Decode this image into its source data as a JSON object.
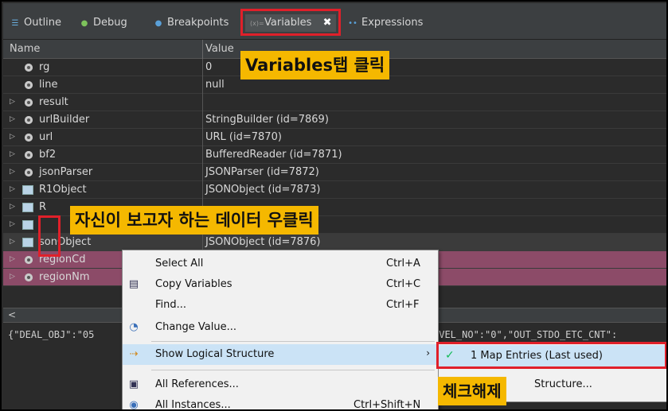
{
  "tabs": [
    {
      "label": "Outline",
      "icon": "outline-icon"
    },
    {
      "label": "Debug",
      "icon": "debug-icon"
    },
    {
      "label": "Breakpoints",
      "icon": "breakpoints-icon"
    },
    {
      "label": "Variables",
      "icon": "variables-icon",
      "active": true
    },
    {
      "label": "Expressions",
      "icon": "expressions-icon"
    }
  ],
  "columns": {
    "name": "Name",
    "value": "Value"
  },
  "rows": [
    {
      "name": "rg",
      "value": "0",
      "expandable": false
    },
    {
      "name": "line",
      "value": "null",
      "expandable": false
    },
    {
      "name": "result",
      "value": "",
      "expandable": true
    },
    {
      "name": "urlBuilder",
      "value": "StringBuilder  (id=7869)",
      "expandable": true
    },
    {
      "name": "url",
      "value": "URL  (id=7870)",
      "expandable": true
    },
    {
      "name": "bf2",
      "value": "BufferedReader  (id=7871)",
      "expandable": true
    },
    {
      "name": "jsonParser",
      "value": "JSONParser  (id=7872)",
      "expandable": true
    },
    {
      "name": "R1Object",
      "value": "JSONObject  (id=7873)",
      "expandable": true
    },
    {
      "name": "R",
      "value": "",
      "expandable": true
    },
    {
      "name": "",
      "value": "",
      "expandable": true
    },
    {
      "name": "sonObject",
      "value": "JSONObject  (id=7876)",
      "expandable": true
    },
    {
      "name": "regionCd",
      "value": "",
      "expandable": true
    },
    {
      "name": "regionNm",
      "value": "",
      "expandable": true
    }
  ],
  "detail": {
    "left": "{\"DEAL_OBJ\":\"05",
    "right": "EVEL_NO\":\"0\",\"OUT_STDO_ETC_CNT\":"
  },
  "callouts": {
    "variables_tab": "Variables탭 클릭",
    "right_click": "자신이 보고자 하는 데이터 우클릭",
    "uncheck": "체크해제"
  },
  "context_menu": {
    "items": [
      {
        "label": "Select All",
        "shortcut": "Ctrl+A",
        "icon": ""
      },
      {
        "label": "Copy Variables",
        "shortcut": "Ctrl+C",
        "icon": "copy-icon"
      },
      {
        "label": "Find...",
        "shortcut": "Ctrl+F",
        "icon": ""
      },
      {
        "label": "Change Value...",
        "shortcut": "",
        "icon": "change-value-icon"
      },
      {
        "label": "Show Logical Structure",
        "shortcut": "",
        "icon": "logical-structure-icon",
        "submenu": true
      },
      {
        "label": "All References...",
        "shortcut": "",
        "icon": "references-icon"
      },
      {
        "label": "All Instances...",
        "shortcut": "Ctrl+Shift+N",
        "icon": "instances-icon"
      }
    ]
  },
  "submenu": {
    "items": [
      {
        "label": "1 Map Entries (Last used)",
        "checked": true
      },
      {
        "label": "Structure...",
        "checked": false
      }
    ]
  },
  "colors": {
    "accent_highlight": "#e0202a",
    "callout_bg": "#f5b800",
    "selected_row": "#8c4b68",
    "panel_bg": "#2b2b2b"
  }
}
